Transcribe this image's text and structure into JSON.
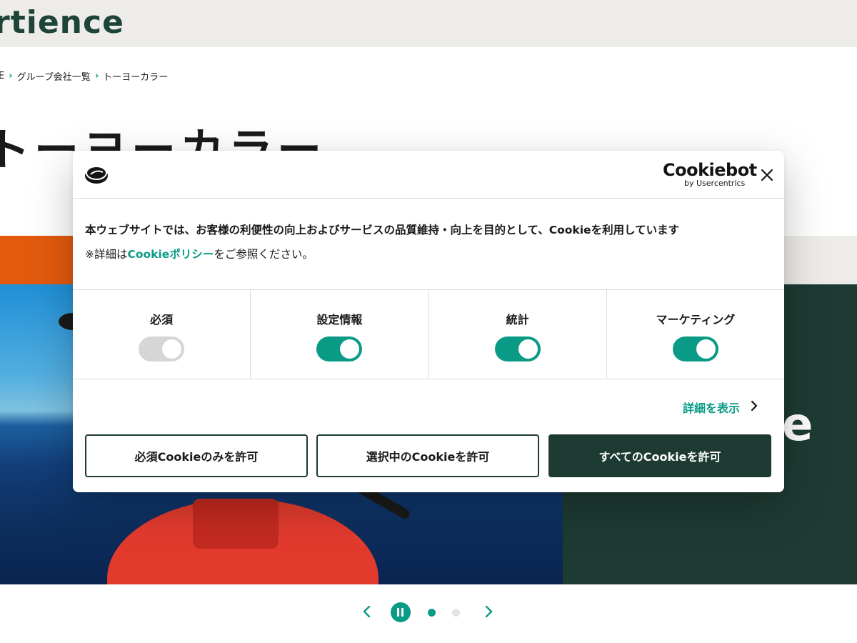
{
  "header": {
    "logo_text": "rtience"
  },
  "breadcrumb": {
    "items": [
      "E",
      "グループ会社一覧",
      "トーヨーカラー"
    ]
  },
  "page": {
    "title": "トーヨーカラー"
  },
  "hero": {
    "right_text": "e"
  },
  "carousel": {
    "prev_icon": "chevron-left-icon",
    "pause_icon": "pause-icon",
    "next_icon": "chevron-right-icon",
    "slides": 2,
    "active_slide": 1
  },
  "cookie_banner": {
    "brand_name": "Cookiebot",
    "brand_sub": "by Usercentrics",
    "message": "本ウェブサイトでは、お客様の利便性の向上およびサービスの品質維持・向上を目的として、Cookieを利用しています",
    "detail_prefix": "※詳細は",
    "policy_link": "Cookieポリシー",
    "detail_suffix": "をご参照ください。",
    "categories": [
      {
        "label": "必須",
        "enabled": true,
        "locked": true
      },
      {
        "label": "設定情報",
        "enabled": true,
        "locked": false
      },
      {
        "label": "統計",
        "enabled": true,
        "locked": false
      },
      {
        "label": "マーケティング",
        "enabled": true,
        "locked": false
      }
    ],
    "show_details": "詳細を表示",
    "buttons": {
      "necessary_only": "必須Cookieのみを許可",
      "selected": "選択中のCookieを許可",
      "all": "すべてのCookieを許可"
    }
  },
  "colors": {
    "accent": "#0a9b86",
    "dark_green": "#1d3b33",
    "header_bg": "#eeece8",
    "orange": "#e35a0e"
  }
}
